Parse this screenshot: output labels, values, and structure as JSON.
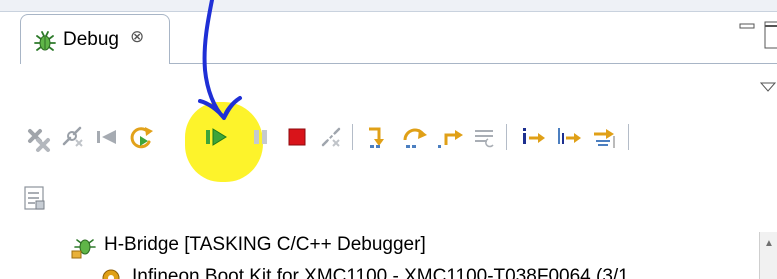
{
  "view": {
    "tab_title": "Debug",
    "tab_close_glyph": "⊗"
  },
  "toolbar": {
    "items": [
      {
        "id": "remove-terminated",
        "icon": "remove-launches-icon"
      },
      {
        "id": "connect",
        "icon": "connect-icon"
      },
      {
        "id": "step-back",
        "icon": "step-back-icon"
      },
      {
        "id": "restart",
        "icon": "restart-icon"
      },
      {
        "id": "resume",
        "icon": "resume-icon",
        "highlighted": true
      },
      {
        "id": "suspend",
        "icon": "suspend-icon"
      },
      {
        "id": "terminate",
        "icon": "terminate-icon"
      },
      {
        "id": "disconnect",
        "icon": "disconnect-icon"
      },
      {
        "id": "step-into",
        "icon": "step-into-icon"
      },
      {
        "id": "step-over",
        "icon": "step-over-icon"
      },
      {
        "id": "step-return",
        "icon": "step-return-icon"
      },
      {
        "id": "drop-to-frame",
        "icon": "drop-to-frame-icon"
      },
      {
        "id": "instruction-stepping",
        "icon": "instruction-stepping-icon"
      },
      {
        "id": "step-into-selection",
        "icon": "step-into-selection-icon"
      },
      {
        "id": "use-step-filters",
        "icon": "use-step-filters-icon"
      }
    ]
  },
  "tree": {
    "items": [
      {
        "label": "H-Bridge [TASKING C/C++ Debugger]",
        "icon": "debug-launch-icon"
      },
      {
        "label": "Infineon Boot Kit for XMC1100 - XMC1100-T038F0064 (3/1",
        "icon": "target-connection-icon"
      }
    ]
  },
  "colors": {
    "highlight": "#fdf32b",
    "annotation_arrow": "#1f2fd6",
    "resume_green": "#3ea53a",
    "terminate_red": "#d9141a"
  }
}
